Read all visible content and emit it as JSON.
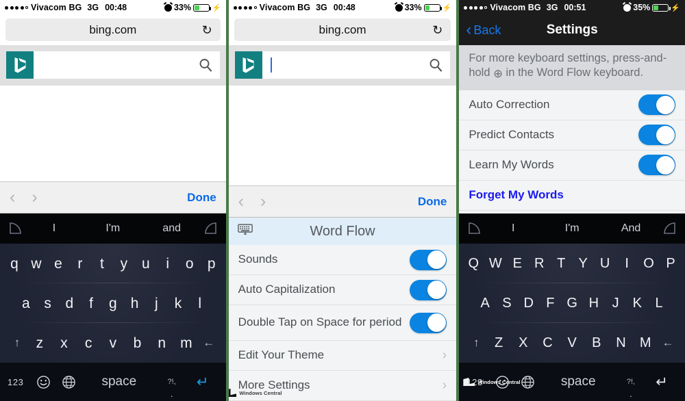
{
  "panel1": {
    "status": {
      "carrier": "Vivacom BG",
      "network": "3G",
      "time": "00:48",
      "battery": "33%",
      "alarm_icon": "alarm-clock-icon",
      "charging_icon": "charging-bolt-icon"
    },
    "browser": {
      "url": "bing.com",
      "reload_icon": "reload-icon"
    },
    "search": {
      "logo": "bing-logo",
      "value": "",
      "search_icon": "magnifier-icon"
    },
    "accessory": {
      "prev_icon": "chevron-left-icon",
      "next_icon": "chevron-right-icon",
      "done_label": "Done"
    },
    "suggestions": {
      "left_icon": "swipe-arc-left-icon",
      "right_icon": "swipe-arc-right-icon",
      "words": [
        "I",
        "I'm",
        "and"
      ]
    },
    "keyboard": {
      "row1": [
        "q",
        "w",
        "e",
        "r",
        "t",
        "y",
        "u",
        "i",
        "o",
        "p"
      ],
      "row2": [
        "a",
        "s",
        "d",
        "f",
        "g",
        "h",
        "j",
        "k",
        "l"
      ],
      "row3": [
        "z",
        "x",
        "c",
        "v",
        "b",
        "n",
        "m"
      ],
      "shift_icon": "shift-arrow-icon",
      "backspace_icon": "backspace-arrow-icon",
      "numeric_label": "123",
      "emoji_icon": "emoji-smiley-icon",
      "globe_icon": "globe-icon",
      "space_label": "space",
      "punct_label": "?!,",
      "punct_dot": "·",
      "enter_icon": "enter-arrow-icon"
    }
  },
  "panel2": {
    "status": {
      "carrier": "Vivacom BG",
      "network": "3G",
      "time": "00:48",
      "battery": "33%",
      "alarm_icon": "alarm-clock-icon",
      "charging_icon": "charging-bolt-icon"
    },
    "browser": {
      "url": "bing.com",
      "reload_icon": "reload-icon"
    },
    "search": {
      "logo": "bing-logo",
      "value": "",
      "search_icon": "magnifier-icon",
      "caret": true
    },
    "accessory": {
      "prev_icon": "chevron-left-icon",
      "next_icon": "chevron-right-icon",
      "done_label": "Done"
    },
    "wordflow": {
      "header_icon": "keyboard-icon",
      "header_title": "Word Flow",
      "rows": [
        {
          "label": "Sounds",
          "control": "toggle",
          "on": true
        },
        {
          "label": "Auto Capitalization",
          "control": "toggle",
          "on": true
        },
        {
          "label": "Double Tap on Space for period",
          "control": "toggle",
          "on": true
        },
        {
          "label": "Edit Your Theme",
          "control": "chevron"
        },
        {
          "label": "More Settings",
          "control": "chevron"
        }
      ]
    },
    "watermark": "Windows Central"
  },
  "panel3": {
    "status": {
      "carrier": "Vivacom BG",
      "network": "3G",
      "time": "00:51",
      "battery": "35%",
      "alarm_icon": "alarm-clock-icon",
      "charging_icon": "charging-bolt-icon"
    },
    "navbar": {
      "back_label": "Back",
      "back_icon": "chevron-left-icon",
      "title": "Settings"
    },
    "note": {
      "part1": "For more keyboard settings, press-and-hold ",
      "glyph": "⊕",
      "part2": " in the Word Flow keyboard."
    },
    "settings": {
      "rows": [
        {
          "label": "Auto Correction",
          "control": "toggle",
          "on": true
        },
        {
          "label": "Predict Contacts",
          "control": "toggle",
          "on": true
        },
        {
          "label": "Learn My Words",
          "control": "toggle",
          "on": true
        },
        {
          "label": "Forget My Words",
          "control": "link"
        }
      ]
    },
    "suggestions": {
      "left_icon": "swipe-arc-left-icon",
      "right_icon": "swipe-arc-right-icon",
      "words": [
        "I",
        "I'm",
        "And"
      ]
    },
    "keyboard": {
      "row1": [
        "Q",
        "W",
        "E",
        "R",
        "T",
        "Y",
        "U",
        "I",
        "O",
        "P"
      ],
      "row2": [
        "A",
        "S",
        "D",
        "F",
        "G",
        "H",
        "J",
        "K",
        "L"
      ],
      "row3": [
        "Z",
        "X",
        "C",
        "V",
        "B",
        "N",
        "M"
      ],
      "shift_icon": "shift-arrow-icon",
      "backspace_icon": "backspace-arrow-icon",
      "numeric_label": "123",
      "emoji_icon": "emoji-smiley-icon",
      "globe_icon": "globe-icon",
      "space_label": "space",
      "punct_label": "?!,",
      "punct_dot": "·",
      "enter_icon": "enter-arrow-icon"
    },
    "watermark": "Windows Central"
  },
  "colors": {
    "bing_teal": "#128080",
    "toggle_blue": "#0a84e0",
    "link_blue": "#1a1aee",
    "done_blue": "#0a6ae8",
    "keyboard_navy": "#1f2435",
    "divider_green": "#4a7a4a"
  }
}
